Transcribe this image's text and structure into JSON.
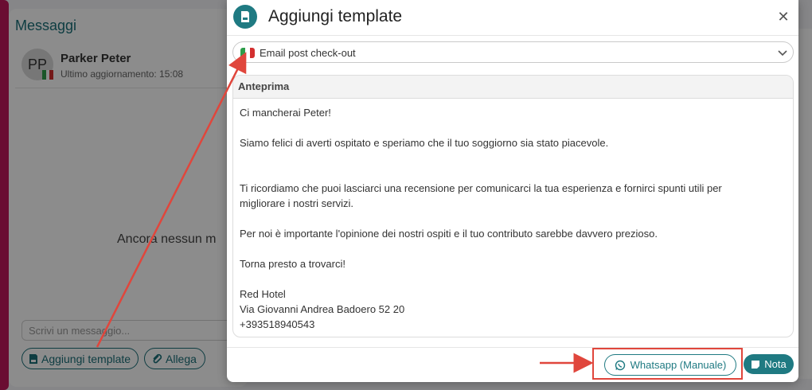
{
  "background": {
    "section_title": "Messaggi",
    "contact": {
      "initials": "PP",
      "name": "Parker Peter",
      "last_update": "Ultimo aggiornamento: 15:08"
    },
    "empty_state": "Ancora nessun m",
    "message_placeholder": "Scrivi un messaggio...",
    "buttons": {
      "add_template": "Aggiungi template",
      "attach": "Allega"
    }
  },
  "modal": {
    "title": "Aggiungi template",
    "close_icon": "close-icon",
    "template_select": {
      "value": "Email post check-out",
      "flag": "italy-flag"
    },
    "preview": {
      "header": "Anteprima",
      "lines": {
        "l1": "Ci mancherai Peter!",
        "l2": "Siamo felici di averti ospitato e speriamo che il tuo soggiorno sia stato piacevole.",
        "l3": "Ti ricordiamo che puoi lasciarci una recensione per comunicarci la tua esperienza e fornirci spunti utili per",
        "l4": "migliorare i nostri servizi.",
        "l5": "Per noi è importante l'opinione dei nostri ospiti e il tuo contributo sarebbe davvero prezioso.",
        "l6": "Torna presto a trovarci!",
        "l7": "Red Hotel",
        "l8": "Via Giovanni Andrea Badoero 52 20",
        "l9": "+393518940543"
      }
    },
    "footer": {
      "whatsapp_label": "Whatsapp (Manuale)",
      "note_label": "Nota"
    }
  },
  "colors": {
    "brand": "#1f7a82",
    "accent": "#c2185b",
    "annotation": "#e0463c"
  }
}
